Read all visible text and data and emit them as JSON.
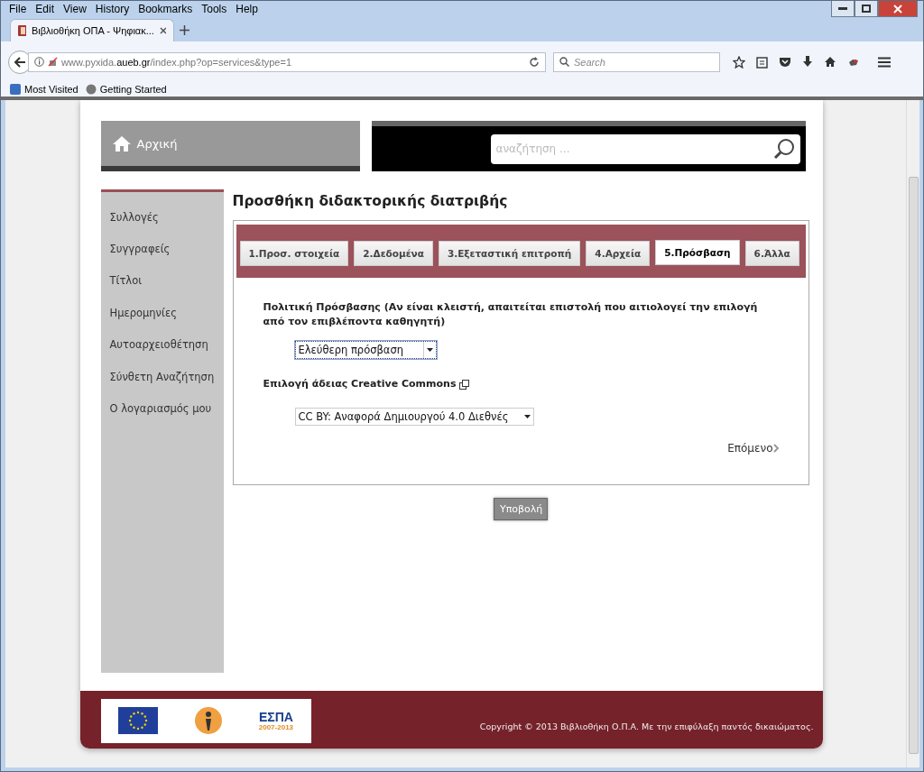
{
  "browser": {
    "menu": [
      "File",
      "Edit",
      "View",
      "History",
      "Bookmarks",
      "Tools",
      "Help"
    ],
    "tabs": [
      {
        "title": "Βιβλιοθήκη ΟΠΑ - Ψηφιακ...",
        "selected": true
      }
    ],
    "url": {
      "prefix": "www.pyxida.",
      "domain": "aueb.gr",
      "path": "/index.php?op=services&type=1"
    },
    "search": {
      "placeholder": "Search"
    },
    "bookmarks": [
      "Most Visited",
      "Getting Started"
    ]
  },
  "header": {
    "home": "Αρχική",
    "search": {
      "placeholder": "αναζήτηση ..."
    }
  },
  "sidebar": {
    "items": [
      "Συλλογές",
      "Συγγραφείς",
      "Τίτλοι",
      "Ημερομηνίες",
      "Αυτοαρχειοθέτηση",
      "Σύνθετη Αναζήτηση",
      "Ο λογαριασμός μου"
    ]
  },
  "page": {
    "title": "Προσθήκη διδακτορικής διατριβής",
    "steps": [
      {
        "label": "1.Προσ. στοιχεία",
        "selected": false
      },
      {
        "label": "2.Δεδομένα",
        "selected": false
      },
      {
        "label": "3.Εξεταστική επιτροπή",
        "selected": false
      },
      {
        "label": "4.Αρχεία",
        "selected": false
      },
      {
        "label": "5.Πρόσβαση",
        "selected": true
      },
      {
        "label": "6.Άλλα",
        "selected": false
      }
    ],
    "fields": [
      {
        "label": "Πολιτική Πρόσβασης (Αν είναι κλειστή, απαιτείται επιστολή που αιτιολογεί την επιλογή από τον επιβλέποντα καθηγητή)",
        "value": "Ελεύθερη πρόσβαση",
        "focused": true,
        "external_link": false
      },
      {
        "label": "Επιλογή άδειας Creative Commons",
        "value": "CC BY: Αναφορά Δημιουργού 4.0 Διεθνές",
        "focused": false,
        "external_link": true
      }
    ],
    "next": "Επόμενο",
    "submit": "Υποβολή"
  },
  "footer": {
    "logo_text": "ΕΣΠΑ",
    "logo_years": "2007-2013",
    "copyright": "Copyright © 2013 Βιβλιοθήκη Ο.Π.Α. Με την επιφύλαξη παντός δικαιώματος."
  }
}
